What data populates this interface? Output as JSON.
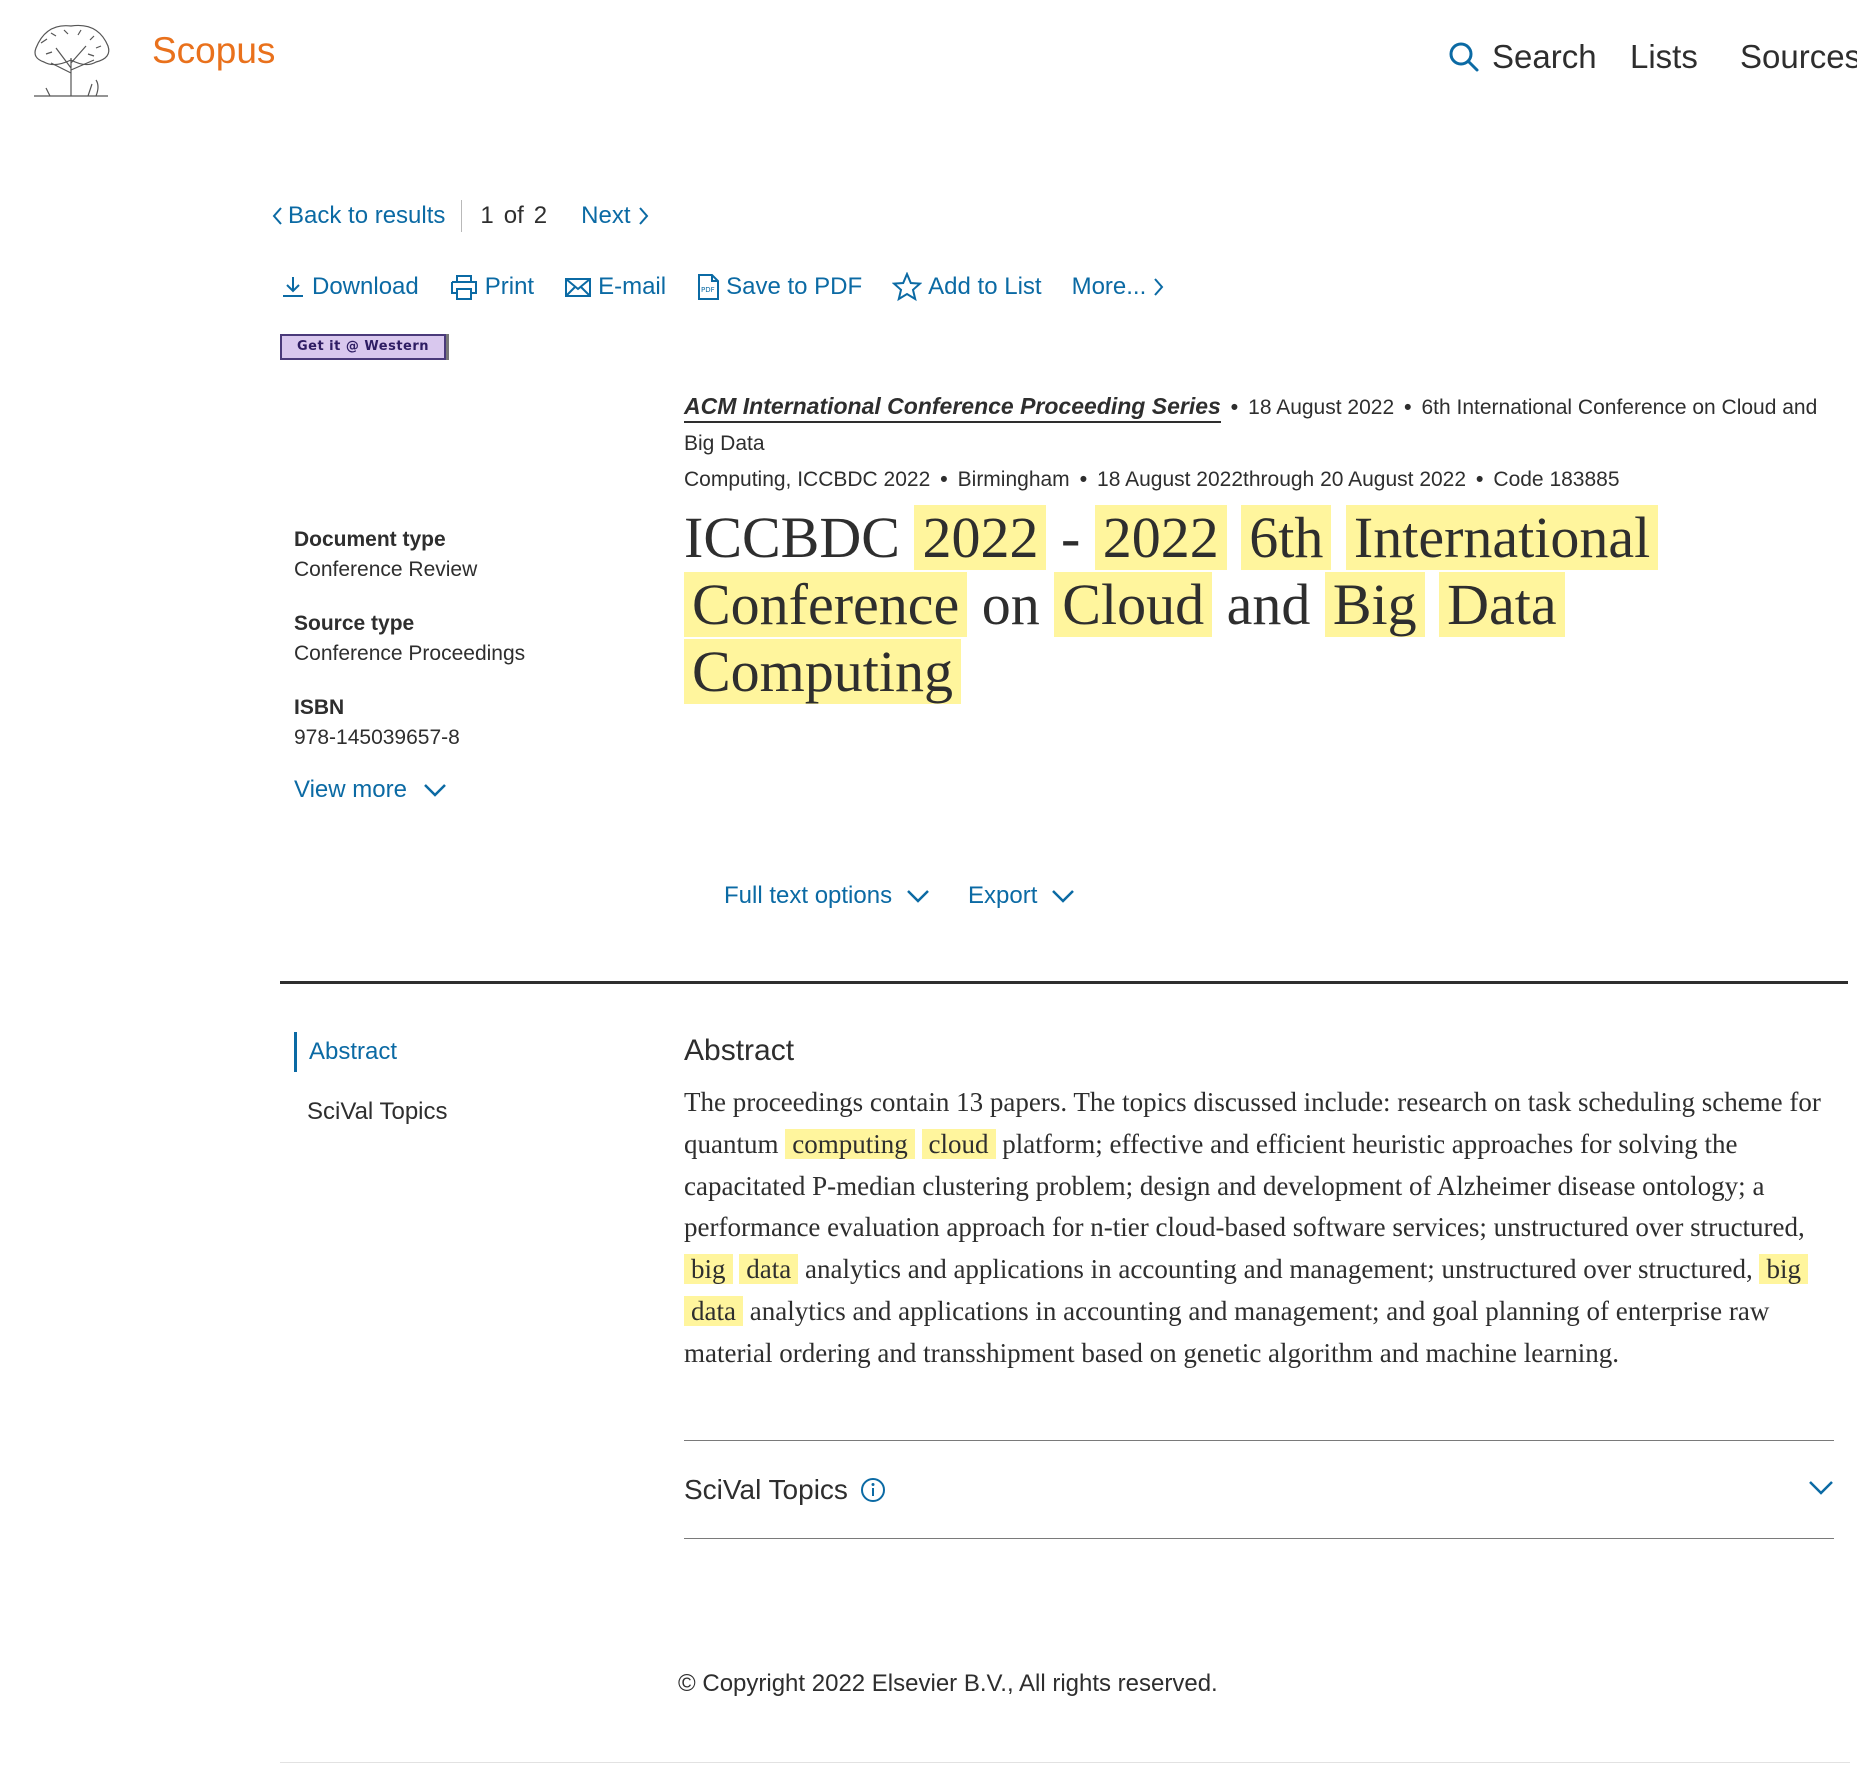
{
  "header": {
    "brand": "Scopus",
    "nav": {
      "search": "Search",
      "lists": "Lists",
      "sources": "Sources"
    }
  },
  "result_nav": {
    "back": "Back to results",
    "current": "1",
    "of": "of",
    "total": "2",
    "next": "Next"
  },
  "toolbar": {
    "download": "Download",
    "print": "Print",
    "email": "E-mail",
    "save_pdf": "Save to PDF",
    "add_list": "Add to List",
    "more": "More..."
  },
  "getit_button": "Get it @ Western",
  "source": {
    "series": "ACM International Conference Proceeding Series",
    "date": "18 August 2022",
    "conference_part1": "6th International Conference on Cloud and Big Data",
    "conference_part2": "Computing, ICCBDC 2022",
    "location": "Birmingham",
    "dates": "18 August 2022through 20 August 2022",
    "code": "Code 183885"
  },
  "title": {
    "w1": "ICCBDC",
    "w2": "2022",
    "w3": "-",
    "w4": "2022",
    "w5": "6th",
    "w6": "International",
    "w7": "Conference",
    "w8": "on",
    "w9": "Cloud",
    "w10": "and",
    "w11": "Big",
    "w12": "Data",
    "w13": "Computing"
  },
  "meta": {
    "doc_type_label": "Document type",
    "doc_type": "Conference Review",
    "source_type_label": "Source type",
    "source_type": "Conference Proceedings",
    "isbn_label": "ISBN",
    "isbn": "978-145039657-8",
    "view_more": "View more"
  },
  "actions": {
    "full_text": "Full text options",
    "export": "Export"
  },
  "sections": {
    "abstract": "Abstract",
    "scival": "SciVal Topics"
  },
  "abstract": {
    "heading": "Abstract",
    "t1": "The proceedings contain 13 papers. The topics discussed include: research on task scheduling scheme for quantum ",
    "h1": "computing",
    "h2": "cloud",
    "t2": " platform; effective and efficient heuristic approaches for solving the capacitated P-median clustering problem; design and development of Alzheimer disease ontology; a performance evaluation approach for n-tier cloud-based software services; unstructured over structured, ",
    "h3": "big",
    "h4": "data",
    "t3": " analytics and applications in accounting and management; unstructured over structured, ",
    "h5": "big",
    "h6": "data",
    "t4": " analytics and applications in accounting and management; and goal planning of enterprise raw material ordering and transshipment based on genetic algorithm and machine learning."
  },
  "scival": {
    "heading": "SciVal Topics"
  },
  "footer": {
    "copyright": "Copyright 2022 Elsevier B.V., All rights reserved.",
    "copyright_symbol": "©"
  },
  "colors": {
    "brand": "#e9711c",
    "link": "#0b6aa4",
    "highlight": "#fff59d",
    "text": "#2e2e2e"
  }
}
